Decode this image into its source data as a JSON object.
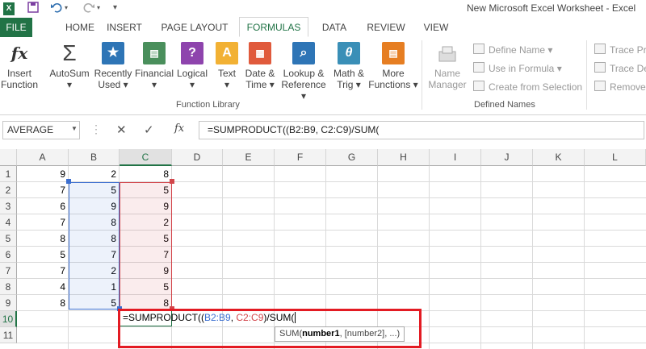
{
  "window": {
    "title": "New Microsoft Excel Worksheet - Excel"
  },
  "tabs": [
    "FILE",
    "HOME",
    "INSERT",
    "PAGE LAYOUT",
    "FORMULAS",
    "DATA",
    "REVIEW",
    "VIEW"
  ],
  "ribbon": {
    "function_library": [
      {
        "l1": "Insert",
        "l2": "Function",
        "icon": "fx-icon"
      },
      {
        "l1": "AutoSum",
        "l2": "▾",
        "icon": "sigma-icon"
      },
      {
        "l1": "Recently",
        "l2": "Used ▾",
        "icon": "star-icon"
      },
      {
        "l1": "Financial",
        "l2": "▾",
        "icon": "financial-icon"
      },
      {
        "l1": "Logical",
        "l2": "▾",
        "icon": "logical-icon"
      },
      {
        "l1": "Text",
        "l2": "▾",
        "icon": "text-icon"
      },
      {
        "l1": "Date &",
        "l2": "Time ▾",
        "icon": "calendar-icon"
      },
      {
        "l1": "Lookup &",
        "l2": "Reference ▾",
        "icon": "lookup-icon"
      },
      {
        "l1": "Math &",
        "l2": "Trig ▾",
        "icon": "math-icon"
      },
      {
        "l1": "More",
        "l2": "Functions ▾",
        "icon": "more-functions-icon"
      }
    ],
    "function_library_label": "Function Library",
    "name_manager": {
      "l1": "Name",
      "l2": "Manager"
    },
    "defined_names": [
      "Define Name ▾",
      "Use in Formula ▾",
      "Create from Selection"
    ],
    "defined_names_label": "Defined Names",
    "auditing": [
      "Trace Pre",
      "Trace De",
      "Remove"
    ]
  },
  "formula_bar": {
    "name_box": "AVERAGE",
    "fx": "fx",
    "formula": "=SUMPRODUCT((B2:B9, C2:C9)/SUM("
  },
  "columns": [
    "A",
    "B",
    "C",
    "D",
    "E",
    "F",
    "G",
    "H",
    "I",
    "J",
    "K",
    "L"
  ],
  "rows": [
    "1",
    "2",
    "3",
    "4",
    "5",
    "6",
    "7",
    "8",
    "9",
    "10",
    "11"
  ],
  "sheet": {
    "A": [
      9,
      7,
      6,
      7,
      8,
      5,
      7,
      4,
      8
    ],
    "B": [
      2,
      5,
      9,
      8,
      8,
      7,
      2,
      1,
      5
    ],
    "C": [
      8,
      5,
      9,
      2,
      5,
      7,
      9,
      5,
      8
    ]
  },
  "edit_cell": {
    "pre": "=SUMPRODUCT((",
    "ref1": "B2:B9",
    "sep": ", ",
    "ref2": "C2:C9",
    "post": ")/SUM(",
    "tooltip_fn": "SUM(",
    "tooltip_arg1": "number1",
    "tooltip_rest": ", [number2], ...)"
  },
  "colors": {
    "accent": "#217346",
    "ref1": "#3c6fd0",
    "ref2": "#d2464b",
    "highlight": "#e31b23"
  }
}
